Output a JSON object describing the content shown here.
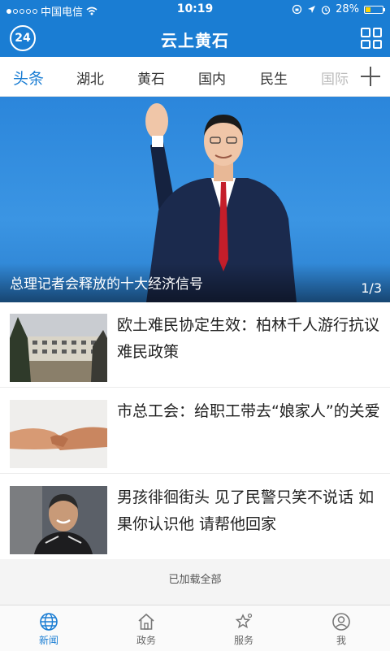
{
  "status": {
    "carrier": "中国电信",
    "time": "10:19",
    "battery": "28%",
    "battery_level": 0.28
  },
  "app": {
    "title": "云上黄石",
    "logo_text": "24"
  },
  "tabs": [
    "头条",
    "湖北",
    "黄石",
    "国内",
    "民生",
    "国际"
  ],
  "hero": {
    "caption": "总理记者会释放的十大经济信号",
    "pager": "1/3"
  },
  "news": [
    {
      "title": "欧土难民协定生效：柏林千人游行抗议难民政策"
    },
    {
      "title": "市总工会：给职工带去“娘家人”的关爱"
    },
    {
      "title": "男孩徘徊街头 见了民警只笑不说话 如果你认识他 请帮他回家"
    }
  ],
  "loaded_text": "已加载全部",
  "bottom_nav": [
    {
      "label": "新闻"
    },
    {
      "label": "政务"
    },
    {
      "label": "服务"
    },
    {
      "label": "我"
    }
  ],
  "colors": {
    "primary": "#1a7dd3",
    "battery": "#ffd400"
  }
}
